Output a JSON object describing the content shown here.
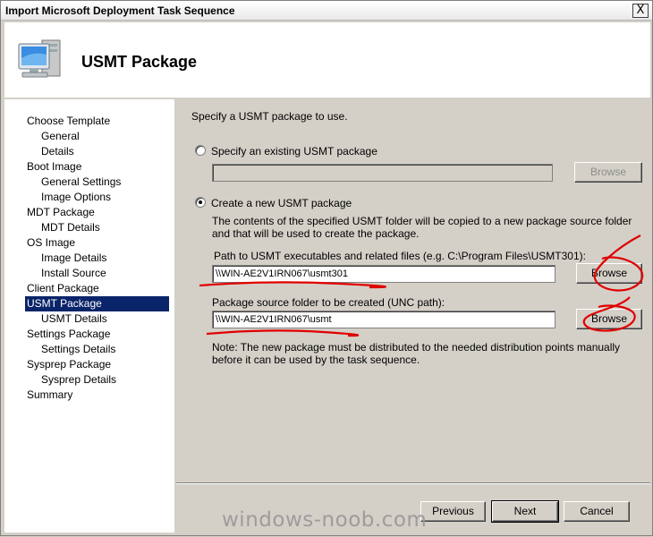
{
  "window": {
    "title": "Import Microsoft Deployment Task Sequence",
    "close_glyph": "X"
  },
  "header": {
    "page_title": "USMT Package",
    "icon": "computer-icon"
  },
  "sidebar": {
    "items": [
      {
        "label": "Choose Template",
        "level": 0
      },
      {
        "label": "General",
        "level": 1
      },
      {
        "label": "Details",
        "level": 1
      },
      {
        "label": "Boot Image",
        "level": 0
      },
      {
        "label": "General Settings",
        "level": 1
      },
      {
        "label": "Image Options",
        "level": 1
      },
      {
        "label": "MDT Package",
        "level": 0
      },
      {
        "label": "MDT Details",
        "level": 1
      },
      {
        "label": "OS Image",
        "level": 0
      },
      {
        "label": "Image Details",
        "level": 1
      },
      {
        "label": "Install Source",
        "level": 1
      },
      {
        "label": "Client Package",
        "level": 0
      },
      {
        "label": "USMT Package",
        "level": 0,
        "selected": true
      },
      {
        "label": "USMT Details",
        "level": 1
      },
      {
        "label": "Settings Package",
        "level": 0
      },
      {
        "label": "Settings Details",
        "level": 1
      },
      {
        "label": "Sysprep Package",
        "level": 0
      },
      {
        "label": "Sysprep Details",
        "level": 1
      },
      {
        "label": "Summary",
        "level": 0
      }
    ]
  },
  "main": {
    "intro": "Specify a USMT package to use.",
    "option_existing": {
      "label": "Specify an existing USMT package",
      "value": "",
      "browse": "Browse",
      "checked": false
    },
    "option_new": {
      "label": "Create a new USMT package",
      "checked": true
    },
    "description": "The contents of the specified USMT folder will be copied to a new package source folder and that will be used to create the package.",
    "path_label": "Path to USMT executables and related files (e.g. C:\\Program Files\\USMT301):",
    "path_value": "\\\\WIN-AE2V1IRN067\\usmt301",
    "path_browse": "Browse",
    "source_label": "Package source folder to be created (UNC path):",
    "source_value": "\\\\WIN-AE2V1IRN067\\usmt",
    "source_browse": "Browse",
    "note": "Note: The new package must be distributed to the needed distribution points manually before it can be used by the task sequence."
  },
  "footer": {
    "previous": "Previous",
    "next": "Next",
    "cancel": "Cancel"
  },
  "watermark": "windows-noob.com",
  "colors": {
    "selection": "#0a246a",
    "annotation": "#e00000",
    "face": "#d4d0c8"
  }
}
